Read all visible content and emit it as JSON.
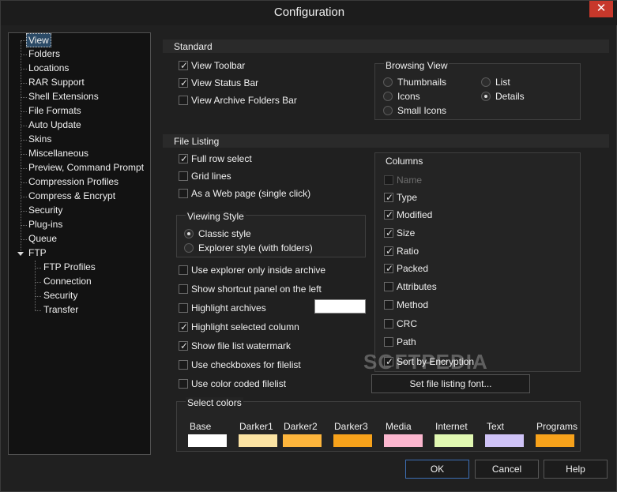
{
  "window": {
    "title": "Configuration",
    "close_glyph": "✕"
  },
  "tree": {
    "items": [
      {
        "label": "View",
        "selected": true
      },
      {
        "label": "Folders"
      },
      {
        "label": "Locations"
      },
      {
        "label": "RAR Support"
      },
      {
        "label": "Shell Extensions"
      },
      {
        "label": "File Formats"
      },
      {
        "label": "Auto Update"
      },
      {
        "label": "Skins"
      },
      {
        "label": "Miscellaneous"
      },
      {
        "label": "Preview, Command Prompt"
      },
      {
        "label": "Compression Profiles"
      },
      {
        "label": "Compress & Encrypt"
      },
      {
        "label": "Security"
      },
      {
        "label": "Plug-ins"
      },
      {
        "label": "Queue"
      },
      {
        "label": "FTP",
        "expanded": true
      }
    ],
    "ftp_children": [
      {
        "label": "FTP Profiles"
      },
      {
        "label": "Connection"
      },
      {
        "label": "Security"
      },
      {
        "label": "Transfer"
      }
    ]
  },
  "standard": {
    "header": "Standard",
    "checkboxes": [
      {
        "label": "View Toolbar",
        "checked": true
      },
      {
        "label": "View Status Bar",
        "checked": true
      },
      {
        "label": "View Archive Folders Bar",
        "checked": false
      }
    ],
    "browsing_view": {
      "label": "Browsing View",
      "options": [
        {
          "label": "Thumbnails",
          "selected": false
        },
        {
          "label": "Icons",
          "selected": false
        },
        {
          "label": "Small Icons",
          "selected": false
        },
        {
          "label": "List",
          "selected": false
        },
        {
          "label": "Details",
          "selected": true
        }
      ]
    }
  },
  "file_listing": {
    "header": "File Listing",
    "top_checkboxes": [
      {
        "label": "Full row select",
        "checked": true
      },
      {
        "label": "Grid lines",
        "checked": false
      },
      {
        "label": "As a Web page (single click)",
        "checked": false
      }
    ],
    "viewing_style": {
      "label": "Viewing Style",
      "options": [
        {
          "label": "Classic style",
          "selected": true
        },
        {
          "label": "Explorer style (with folders)",
          "selected": false
        }
      ]
    },
    "bottom_checkboxes": [
      {
        "label": "Use explorer only inside archive",
        "checked": false
      },
      {
        "label": "Show shortcut panel on the left",
        "checked": false
      },
      {
        "label": "Highlight archives",
        "checked": false
      },
      {
        "label": "Highlight selected column",
        "checked": true
      },
      {
        "label": "Show file list watermark",
        "checked": true
      },
      {
        "label": "Use checkboxes for filelist",
        "checked": false
      },
      {
        "label": "Use color coded filelist",
        "checked": false
      }
    ],
    "highlight_color": "#ffffff",
    "columns": {
      "label": "Columns",
      "items": [
        {
          "label": "Name",
          "checked": false,
          "disabled": true
        },
        {
          "label": "Type",
          "checked": true
        },
        {
          "label": "Modified",
          "checked": true
        },
        {
          "label": "Size",
          "checked": true
        },
        {
          "label": "Ratio",
          "checked": true
        },
        {
          "label": "Packed",
          "checked": true
        },
        {
          "label": "Attributes",
          "checked": false
        },
        {
          "label": "Method",
          "checked": false
        },
        {
          "label": "CRC",
          "checked": false
        },
        {
          "label": "Path",
          "checked": false
        },
        {
          "label": "Sort by Encryption",
          "checked": true
        }
      ]
    },
    "font_button": "Set file listing font...",
    "watermark_text": "SOFTPEDIA"
  },
  "select_colors": {
    "label": "Select colors",
    "swatches": [
      {
        "label": "Base",
        "color": "#ffffff"
      },
      {
        "label": "Darker1",
        "color": "#fbe3a3"
      },
      {
        "label": "Darker2",
        "color": "#fdb53c"
      },
      {
        "label": "Darker3",
        "color": "#f7a21b"
      },
      {
        "label": "Media",
        "color": "#fbb6ce"
      },
      {
        "label": "Internet",
        "color": "#e1f8b2"
      },
      {
        "label": "Text",
        "color": "#cfc3f7"
      },
      {
        "label": "Programs",
        "color": "#f7a21b"
      }
    ]
  },
  "buttons": {
    "ok": "OK",
    "cancel": "Cancel",
    "help": "Help"
  }
}
